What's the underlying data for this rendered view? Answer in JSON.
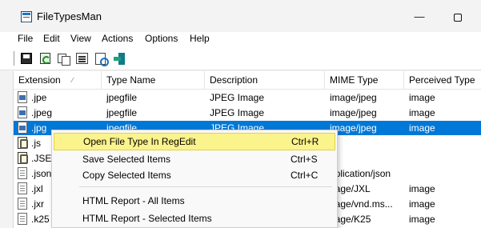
{
  "window": {
    "title": "FileTypesMan",
    "minimize_glyph": "—",
    "icons": {
      "app": "app-icon",
      "minimize": "minimize-icon",
      "maximize": "maximize-icon"
    }
  },
  "menubar": {
    "items": [
      "File",
      "Edit",
      "View",
      "Actions",
      "Options",
      "Help"
    ]
  },
  "toolbar": {
    "buttons": [
      "save-icon",
      "refresh-icon",
      "copy-icon",
      "properties-icon",
      "find-icon",
      "exit-icon"
    ]
  },
  "list": {
    "columns": [
      "Extension",
      "Type Name",
      "Description",
      "MIME Type",
      "Perceived Type"
    ],
    "sort_indicator": "∕",
    "sorted_column": "Extension",
    "rows": [
      {
        "icon": "image-file-icon",
        "extension": ".jpe",
        "type_name": "jpegfile",
        "description": "JPEG Image",
        "mime": "image/jpeg",
        "perceived": "image",
        "selected": false
      },
      {
        "icon": "image-file-icon",
        "extension": ".jpeg",
        "type_name": "jpegfile",
        "description": "JPEG Image",
        "mime": "image/jpeg",
        "perceived": "image",
        "selected": false
      },
      {
        "icon": "image-file-icon",
        "extension": ".jpg",
        "type_name": "jpegfile",
        "description": "JPEG Image",
        "mime": "image/jpeg",
        "perceived": "image",
        "selected": true
      },
      {
        "icon": "script-file-icon",
        "extension": ".js",
        "type_name": "",
        "description": "",
        "mime": "",
        "perceived": "",
        "selected": false
      },
      {
        "icon": "script-file-icon",
        "extension": ".JSE",
        "type_name": "",
        "description": "",
        "mime": "",
        "perceived": "",
        "selected": false
      },
      {
        "icon": "document-file-icon",
        "extension": ".json",
        "type_name": "",
        "description": "",
        "mime": "pplication/json",
        "perceived": "",
        "selected": false
      },
      {
        "icon": "document-file-icon",
        "extension": ".jxl",
        "type_name": "",
        "description": "",
        "mime": "nage/JXL",
        "perceived": "image",
        "selected": false
      },
      {
        "icon": "document-file-icon",
        "extension": ".jxr",
        "type_name": "",
        "description": "",
        "mime": "nage/vnd.ms...",
        "perceived": "image",
        "selected": false
      },
      {
        "icon": "document-file-icon",
        "extension": ".k25",
        "type_name": "",
        "description": "",
        "mime": "nage/K25",
        "perceived": "image",
        "selected": false
      }
    ]
  },
  "context_menu": {
    "items": [
      {
        "label": "Open File Type In RegEdit",
        "shortcut": "Ctrl+R",
        "highlighted": true
      },
      {
        "label": "Save Selected Items",
        "shortcut": "Ctrl+S",
        "highlighted": false
      },
      {
        "label": "Copy Selected Items",
        "shortcut": "Ctrl+C",
        "highlighted": false
      },
      {
        "label": "HTML Report - All Items",
        "shortcut": "",
        "highlighted": false
      },
      {
        "label": "HTML Report - Selected Items",
        "shortcut": "",
        "highlighted": false
      }
    ]
  },
  "colors": {
    "selection": "#0078d7",
    "menu_highlight": "#fbf38c",
    "menu_highlight_border": "#e3d341"
  }
}
